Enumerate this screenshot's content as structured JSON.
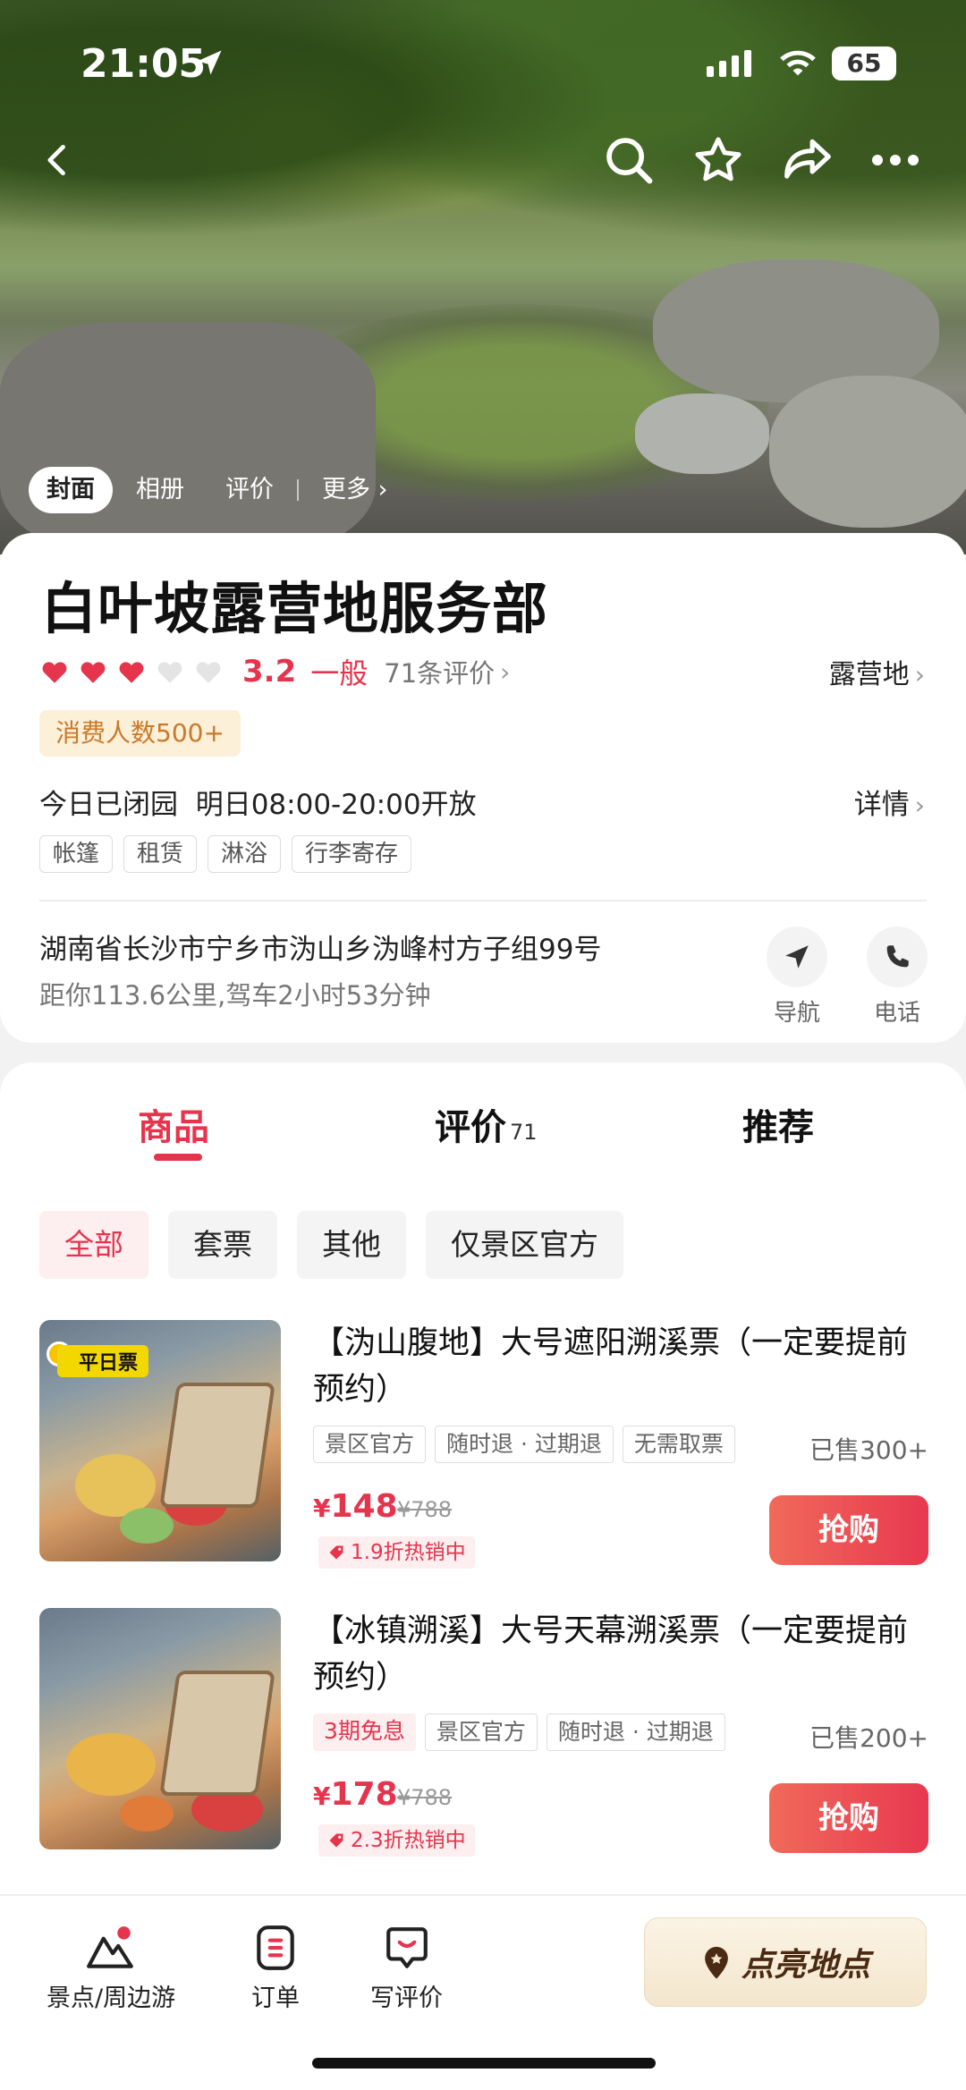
{
  "status_bar": {
    "time": "21:05",
    "battery": "65"
  },
  "photo_tabs": [
    {
      "label": "封面",
      "active": true
    },
    {
      "label": "相册",
      "active": false
    },
    {
      "label": "评价",
      "active": false
    },
    {
      "label": "更多",
      "active": false
    }
  ],
  "poi": {
    "title": "白叶坡露营地服务部",
    "hearts_filled": 3,
    "hearts_total": 5,
    "score": "3.2",
    "level": "一般",
    "review_count": "71条评价",
    "category": "露营地",
    "visitors": "消费人数500+",
    "hours": "今日已闭园  明日08:00-20:00开放",
    "detail_label": "详情",
    "tags": [
      "帐篷",
      "租赁",
      "淋浴",
      "行李寄存"
    ],
    "address": "湖南省长沙市宁乡市沩山乡沩峰村方子组99号",
    "distance": "距你113.6公里,驾车2小时53分钟",
    "nav_label": "导航",
    "phone_label": "电话"
  },
  "content_tabs": [
    {
      "label": "商品",
      "badge": ""
    },
    {
      "label": "评价",
      "badge": "71"
    },
    {
      "label": "推荐",
      "badge": ""
    }
  ],
  "filters": [
    {
      "label": "全部",
      "active": true
    },
    {
      "label": "套票",
      "active": false
    },
    {
      "label": "其他",
      "active": false
    },
    {
      "label": "仅景区官方",
      "active": false
    }
  ],
  "products": [
    {
      "name": "【沩山腹地】大号遮阳溯溪票（一定要提前预约）",
      "thumb_badge": "平日票",
      "badges": [
        "景区官方",
        "随时退 · 过期退",
        "无需取票"
      ],
      "sold": "已售300+",
      "price": "148",
      "original_price": "¥788",
      "discount": "1.9折热销中",
      "buy_label": "抢购"
    },
    {
      "name": "【冰镇溯溪】大号天幕溯溪票（一定要提前预约）",
      "thumb_badge": "",
      "badges": [
        "3期免息",
        "景区官方",
        "随时退 · 过期退"
      ],
      "sold": "已售200+",
      "price": "178",
      "original_price": "¥788",
      "discount": "2.3折热销中",
      "buy_label": "抢购"
    }
  ],
  "bottom_nav": {
    "items": [
      {
        "label": "景点/周边游"
      },
      {
        "label": "订单"
      },
      {
        "label": "写评价"
      }
    ],
    "light_up_label": "点亮地点"
  },
  "colors": {
    "accent": "#e6344d",
    "gold": "#c9792a"
  }
}
